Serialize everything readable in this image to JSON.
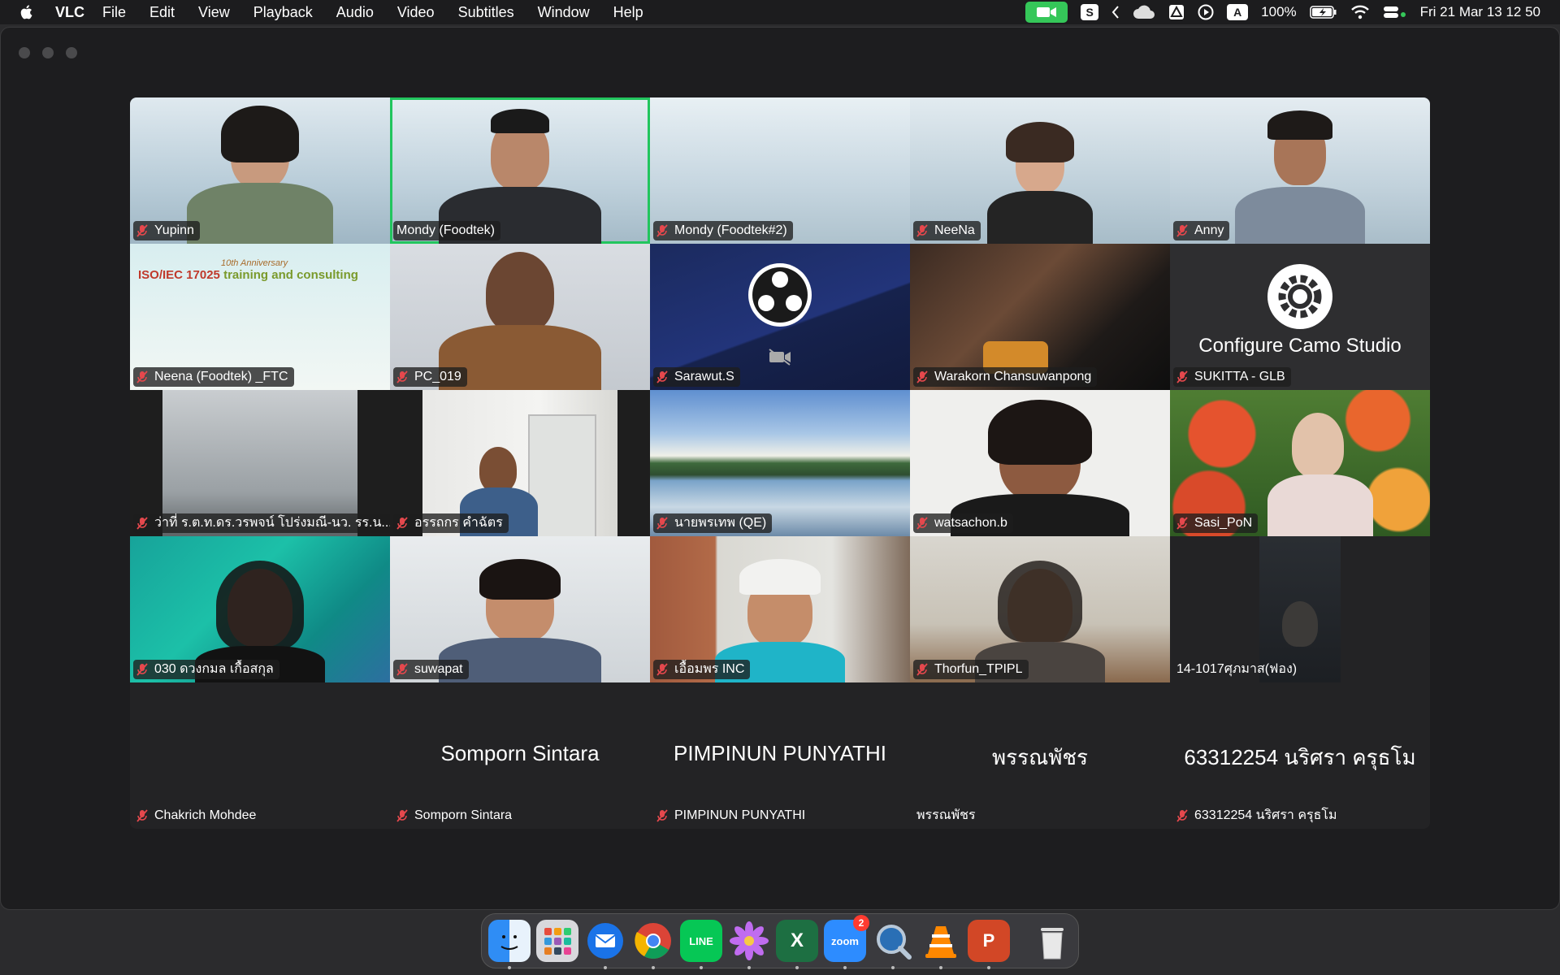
{
  "menubar": {
    "app_name": "VLC",
    "items": [
      "File",
      "Edit",
      "View",
      "Playback",
      "Audio",
      "Video",
      "Subtitles",
      "Window",
      "Help"
    ],
    "status": {
      "s_label": "S",
      "a_label": "A",
      "battery": "100%",
      "datetime": "Fri 21 Mar  13 12 50"
    }
  },
  "meeting": {
    "participants": [
      {
        "name": "Yupinn",
        "muted": true
      },
      {
        "name": "Mondy (Foodtek)",
        "muted": false,
        "active_speaker": true
      },
      {
        "name": "Mondy (Foodtek#2)",
        "muted": true
      },
      {
        "name": "NeeNa",
        "muted": true
      },
      {
        "name": "Anny",
        "muted": true
      },
      {
        "name": "Neena (Foodtek) _FTC",
        "muted": true,
        "banner_year": "10th Anniversary",
        "banner_text_1": "ISO/IEC 17025",
        "banner_text_2": "training and consulting"
      },
      {
        "name": "PC_019",
        "muted": true
      },
      {
        "name": "Sarawut.S",
        "muted": true
      },
      {
        "name": "Warakorn Chansuwanpong",
        "muted": true
      },
      {
        "name": "SUKITTA - GLB",
        "muted": true,
        "overlay_text": "Configure Camo Studio"
      },
      {
        "name": "ว่าที่ ร.ต.ท.ดร.วรพจน์ โปร่งมณี-นว. รร.น...",
        "muted": true
      },
      {
        "name": "อรรถกร คำฉัตร",
        "muted": true
      },
      {
        "name": "นายพรเทพ (QE)",
        "muted": true
      },
      {
        "name": "watsachon.b",
        "muted": true
      },
      {
        "name": "Sasi_PoN",
        "muted": true
      },
      {
        "name": "030 ดวงกมล  เกื้อสกุล",
        "muted": true
      },
      {
        "name": "suwapat",
        "muted": true
      },
      {
        "name": "เอื้อมพร INC",
        "muted": true
      },
      {
        "name": "Thorfun_TPIPL",
        "muted": true
      },
      {
        "name": "14-1017ศุภมาส(ฟอง)",
        "muted": false
      },
      {
        "name": "Chakrich Mohdee",
        "muted": true,
        "center": ""
      },
      {
        "name": "Somporn Sintara",
        "muted": true,
        "center": "Somporn Sintara"
      },
      {
        "name": "PIMPINUN PUNYATHI",
        "muted": true,
        "center": "PIMPINUN PUNYATHI"
      },
      {
        "name": "พรรณพัชร",
        "muted": false,
        "center": "พรรณพัชร"
      },
      {
        "name": "63312254 นริศรา ครุธโม",
        "muted": true,
        "center": "63312254 นริศรา ครุธโม"
      }
    ]
  },
  "dock": {
    "apps": [
      "finder-icon",
      "launchpad-icon",
      "thunderbird-icon",
      "chrome-icon",
      "line-icon",
      "flower-icon",
      "excel-icon",
      "zoom-icon",
      "quicktime-icon",
      "vlc-icon",
      "powerpoint-icon",
      "trash-icon"
    ],
    "line_label": "LINE",
    "zoom_label": "zoom",
    "zoom_badge": "2",
    "excel_label": "X",
    "powerpoint_label": "P"
  }
}
